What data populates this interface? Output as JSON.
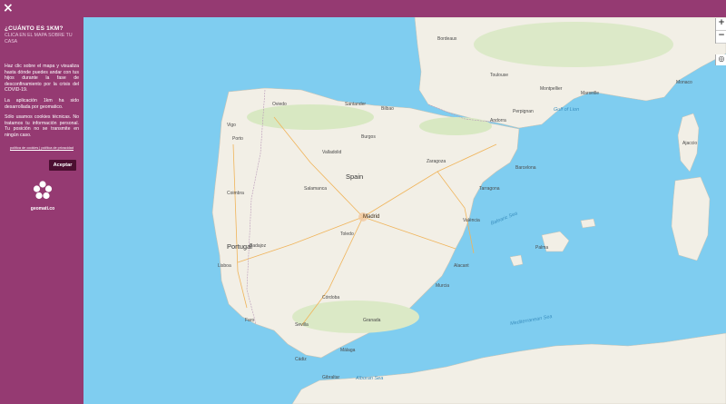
{
  "header": {
    "close_label": "×"
  },
  "sidebar": {
    "title": "¿CUÁNTO ES 1KM?",
    "subtitle": "CLICA EN EL MAPA SOBRE TU CASA",
    "paragraph1": "Haz clic sobre el mapa y visualiza hasta dónde puedes andar con tus hijos durante la fase de desconfinamiento por la crisis del COVID-19.",
    "paragraph2": "La aplicación 1km ha sido desarrollada por geomatico.",
    "paragraph3": "Sólo usamos cookies técnicas. No tratamos tu información personal. Tu posición no se transmite en ningún caso.",
    "legal_link": "política de cookies | política de privacidad",
    "accept_label": "Aceptar",
    "logo_text": "geomati.co"
  },
  "map": {
    "zoom_in": "+",
    "zoom_out": "−",
    "labels": {
      "spain": "Spain",
      "portugal": "Portugal",
      "andorra": "Andorra",
      "monaco": "Monaco",
      "madrid": "Madrid",
      "gibraltar": "Gibraltar",
      "mediterranean": "Mediterranean Sea",
      "balearic": "Balearic Sea",
      "alboran": "Alboran Sea",
      "gulf_lion": "Gulf of Lion",
      "porto": "Porto",
      "lisboa": "Lisboa",
      "sevilla": "Sevilla",
      "valencia": "València",
      "barcelona": "Barcelona",
      "zaragoza": "Zaragoza",
      "bilbao": "Bilbao",
      "malaga": "Málaga",
      "murcia": "Murcia",
      "marseille": "Marseille",
      "toulouse": "Toulouse",
      "bordeaux": "Bordeaux",
      "valladolid": "Valladolid",
      "granada": "Granada",
      "cordoba": "Córdoba",
      "salamanca": "Salamanca",
      "toledo": "Toledo",
      "palma": "Palma",
      "oviedo": "Oviedo",
      "santander": "Santander",
      "vigo": "Vigo",
      "burgos": "Burgos",
      "alicante": "Alacant",
      "tarragona": "Tarragona",
      "cadiz": "Cádiz",
      "badajoz": "Badajoz",
      "coimbra": "Coimbra",
      "faro": "Faro",
      "montpellier": "Montpellier",
      "perpignan": "Perpignan",
      "ajaccio": "Ajaccio"
    }
  },
  "colors": {
    "brand": "#953a72",
    "button": "#4b0f31",
    "sea": "#7fcdf0",
    "land": "#f2efe6",
    "green": "#cfe3b4"
  }
}
